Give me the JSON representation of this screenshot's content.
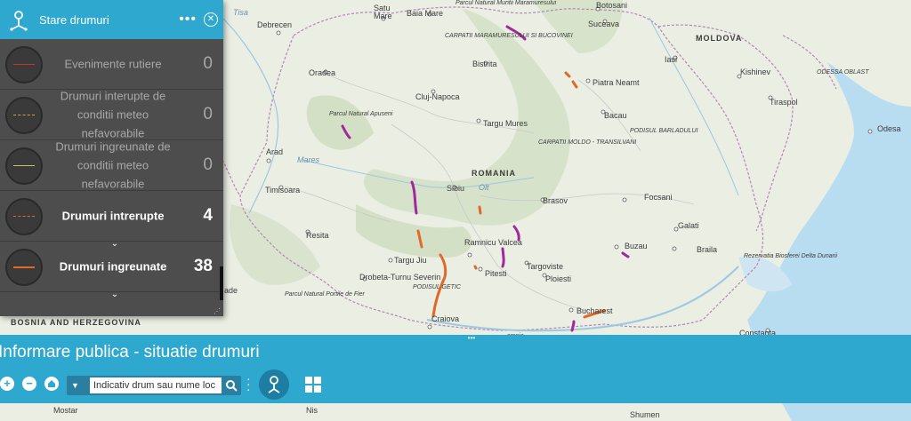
{
  "panel": {
    "title": "Stare drumuri",
    "menu_icon": "ellipsis-icon",
    "close_icon": "close-circle-icon",
    "items": [
      {
        "label": "Evenimente rutiere",
        "count": "0",
        "line_color": "#c0392b",
        "line_style": "solid",
        "active": false
      },
      {
        "label": "Drumuri interupte de conditii meteo nefavorabile",
        "count": "0",
        "line_color": "#c8a93a",
        "line_style": "dashed",
        "active": false
      },
      {
        "label": "Drumuri ingreunate de conditii meteo nefavorabile",
        "count": "0",
        "line_color": "#c6c25a",
        "line_style": "solid",
        "active": false
      },
      {
        "label": "Drumuri intrerupte",
        "count": "4",
        "line_color": "#e2682a",
        "line_style": "dashed",
        "active": true
      },
      {
        "label": "Drumuri ingreunate",
        "count": "38",
        "line_color": "#e2682a",
        "line_style": "solid",
        "active": true
      }
    ]
  },
  "bottombar": {
    "title": "Informare publica - situatie drumuri",
    "search": {
      "placeholder": "Indicativ drum sau nume loc"
    },
    "buttons": [
      "zoom-in-icon",
      "zoom-out-icon",
      "home-icon",
      "legend-icon",
      "grid-icon"
    ]
  },
  "map": {
    "labels": [
      {
        "t": "Satu",
        "c": "Mare"
      },
      "Baia Mare",
      "Debrecen",
      "Oradea",
      "Cluj-Napoca",
      "Bistrita",
      "Suceava",
      "Botosani",
      "Iasi",
      "Piatra Neamt",
      "Bacau",
      "Targu Mures",
      "Sibiu",
      "Brasov",
      "Arad",
      "Timisoara",
      "Resita",
      "Targu Jiu",
      "Ramnicu Valcea",
      "Pitesti",
      "Targoviste",
      "Ploiesti",
      "Bucharest",
      "Focsani",
      "Buzau",
      "Galati",
      "Braila",
      "Constanta",
      "Kishinev",
      "Tiraspol",
      "Odesa",
      "Craiova",
      "Drobeta-Turnu Severin",
      "Mostar",
      "Nis",
      "Shumen",
      "Mares",
      "Olt"
    ],
    "regions": [
      "ROMANIA",
      "MOLDOVA",
      "ODESSA OBLAST",
      "BOSNIA AND HERZEGOVINA",
      "CARPATII MOLDO - TRANSILVANI",
      "PODISUL BARLADULUI",
      "PODISUL GETIC",
      "CARPATII MARAMURESULUI SI BUCOVINEI"
    ],
    "parks": [
      "Parcul Natural Apuseni",
      "Parcul Natural Portile de Fier",
      "Rezervatia Biosferei Delta Dunarii",
      "Parcul Natural Muntii Maramuresului"
    ],
    "river": "Tisa",
    "partial": [
      "ade",
      "amnia"
    ]
  },
  "colors": {
    "accent": "#2ea8cf",
    "panel_bg": "#4d4d4d",
    "closed_road": "#a0289a",
    "difficult_road": "#e2682a"
  }
}
